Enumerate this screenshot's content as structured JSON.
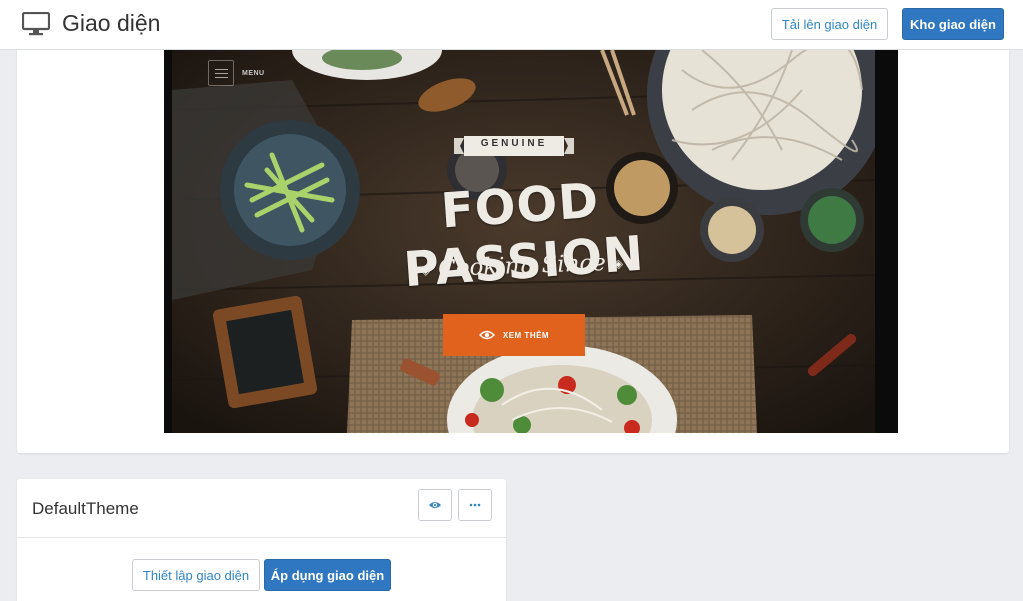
{
  "header": {
    "title": "Giao diện",
    "upload_label": "Tải lên giao diện",
    "store_label": "Kho giao diện"
  },
  "preview": {
    "menu_label": "MENU",
    "banner_label": "GENUINE",
    "hero_title": "FOOD PASSION",
    "hero_subtitle": "Cooking Since",
    "cta_label": "XEM THÊM"
  },
  "theme": {
    "name": "DefaultTheme",
    "setup_label": "Thiết lập giao diện",
    "apply_label": "Áp dụng giao diện"
  },
  "icons": {
    "page": "monitor-icon",
    "preview": "eye-icon",
    "more": "ellipsis-icon",
    "cta": "eye-icon"
  },
  "colors": {
    "primary": "#2f77c0",
    "link": "#2f86c6",
    "cta": "#e0621d",
    "background": "#ebedf0"
  }
}
